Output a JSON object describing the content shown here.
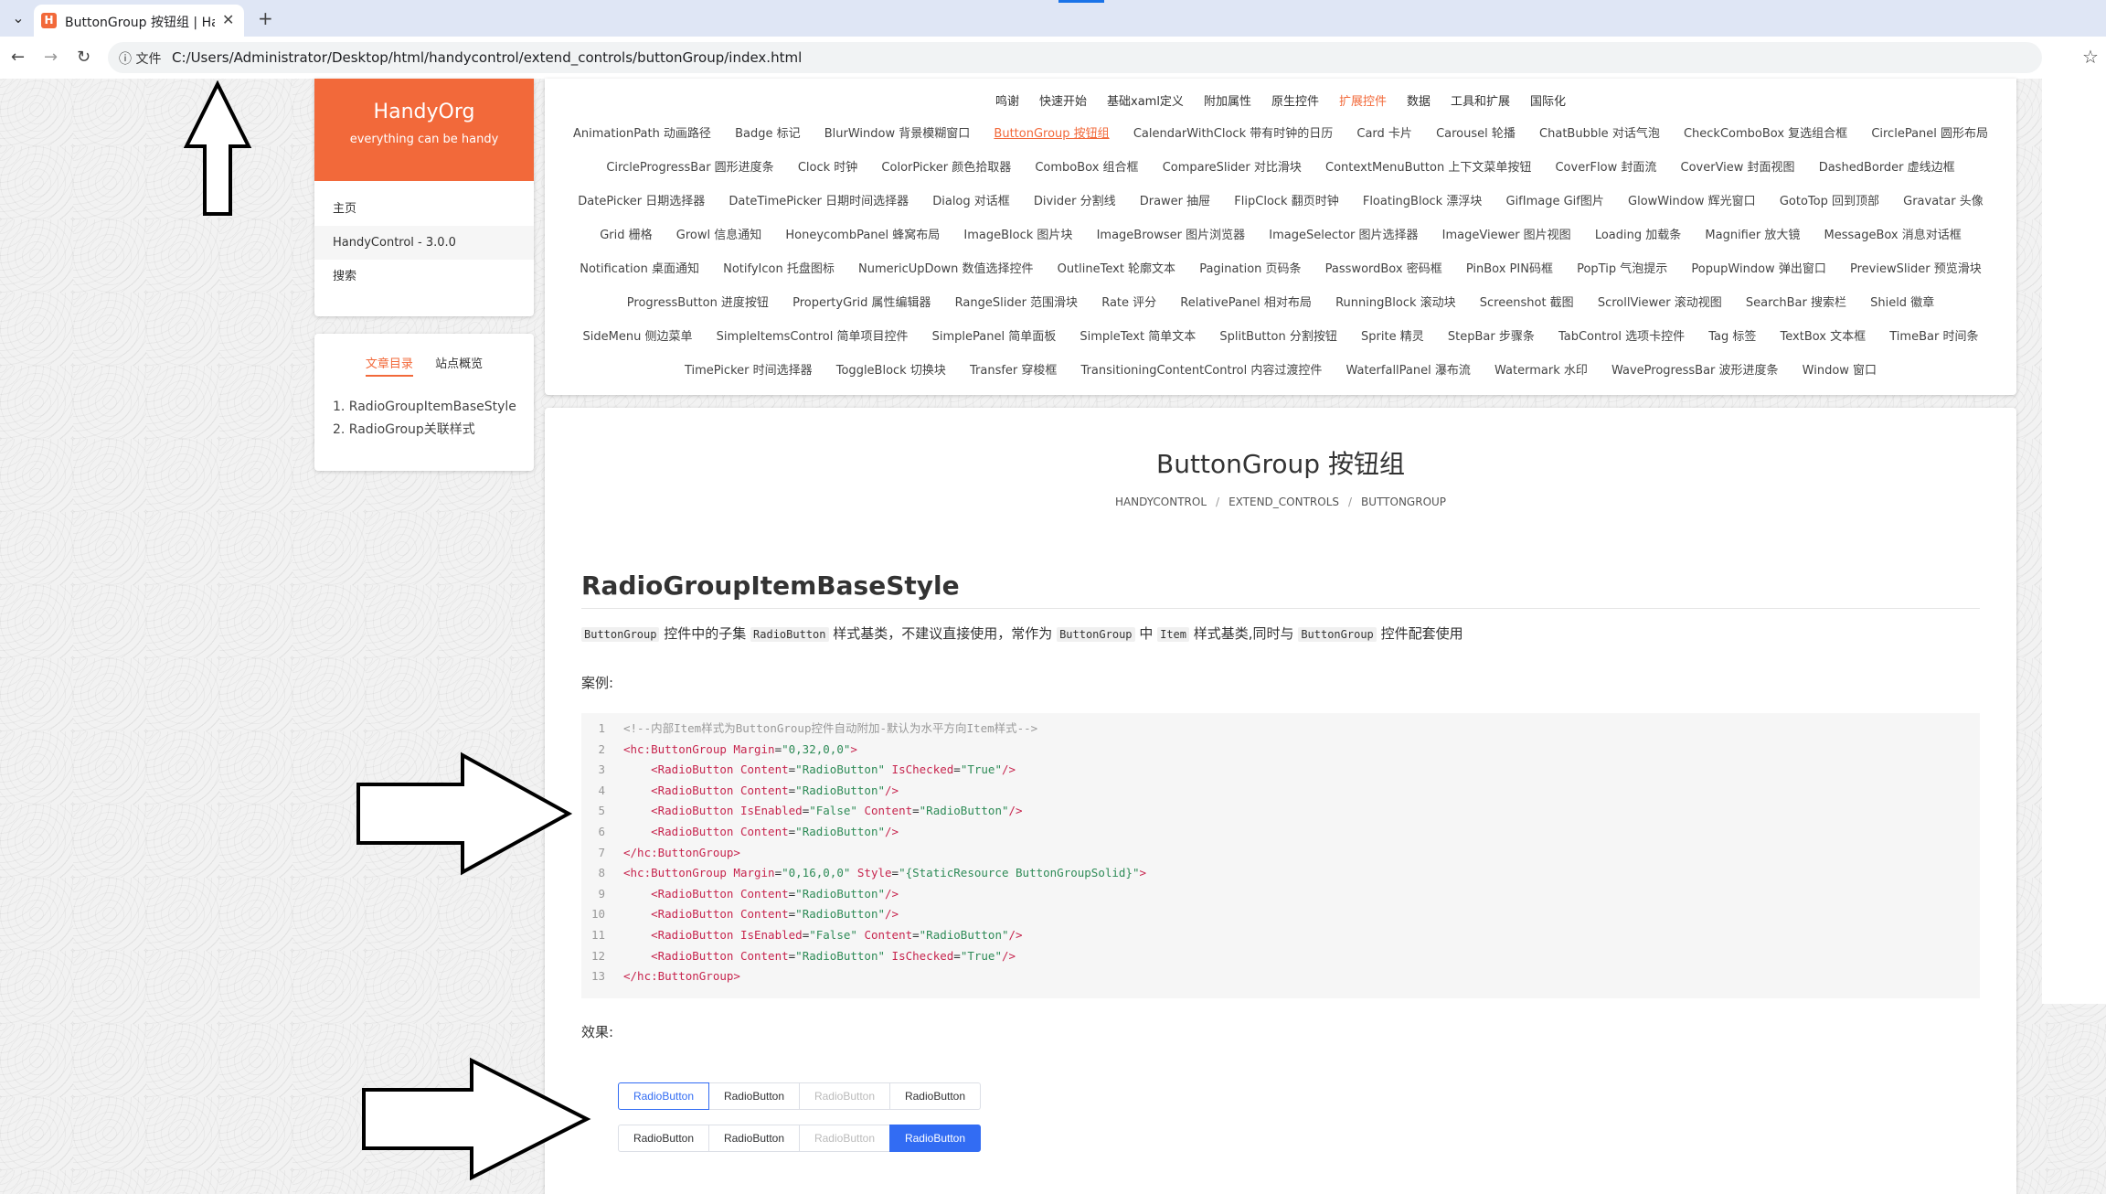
{
  "browser": {
    "tab_title": "ButtonGroup 按钮组 | HandyControl",
    "favicon_letter": "H",
    "site_info": "文件",
    "url": "C:/Users/Administrator/Desktop/html/handycontrol/extend_controls/buttonGroup/index.html"
  },
  "brand": {
    "title": "HandyOrg",
    "subtitle": "everything can be handy"
  },
  "nav": {
    "items": [
      "主页",
      "HandyControl - 3.0.0",
      "搜索"
    ]
  },
  "toc": {
    "tabs": [
      "文章目录",
      "站点概览"
    ],
    "items": [
      "1. RadioGroupItemBaseStyle",
      "2. RadioGroup关联样式"
    ]
  },
  "top_menu": [
    "鸣谢",
    "快速开始",
    "基础xaml定义",
    "附加属性",
    "原生控件",
    "扩展控件",
    "数据",
    "工具和扩展",
    "国际化"
  ],
  "controls": [
    "AnimationPath 动画路径",
    "Badge 标记",
    "BlurWindow 背景模糊窗口",
    "ButtonGroup 按钮组",
    "CalendarWithClock 带有时钟的日历",
    "Card 卡片",
    "Carousel 轮播",
    "ChatBubble 对话气泡",
    "CheckComboBox 复选组合框",
    "CirclePanel 圆形布局",
    "CircleProgressBar 圆形进度条",
    "Clock 时钟",
    "ColorPicker 颜色拾取器",
    "ComboBox 组合框",
    "CompareSlider 对比滑块",
    "ContextMenuButton 上下文菜单按钮",
    "CoverFlow 封面流",
    "CoverView 封面视图",
    "DashedBorder 虚线边框",
    "DatePicker 日期选择器",
    "DateTimePicker 日期时间选择器",
    "Dialog 对话框",
    "Divider 分割线",
    "Drawer 抽屉",
    "FlipClock 翻页时钟",
    "FloatingBlock 漂浮块",
    "GifImage Gif图片",
    "GlowWindow 辉光窗口",
    "GotoTop 回到顶部",
    "Gravatar 头像",
    "Grid 栅格",
    "Growl 信息通知",
    "HoneycombPanel 蜂窝布局",
    "ImageBlock 图片块",
    "ImageBrowser 图片浏览器",
    "ImageSelector 图片选择器",
    "ImageViewer 图片视图",
    "Loading 加载条",
    "Magnifier 放大镜",
    "MessageBox 消息对话框",
    "Notification 桌面通知",
    "NotifyIcon 托盘图标",
    "NumericUpDown 数值选择控件",
    "OutlineText 轮廓文本",
    "Pagination 页码条",
    "PasswordBox 密码框",
    "PinBox PIN码框",
    "PopTip 气泡提示",
    "PopupWindow 弹出窗口",
    "PreviewSlider 预览滑块",
    "ProgressButton 进度按钮",
    "PropertyGrid 属性编辑器",
    "RangeSlider 范围滑块",
    "Rate 评分",
    "RelativePanel 相对布局",
    "RunningBlock 滚动块",
    "Screenshot 截图",
    "ScrollViewer 滚动视图",
    "SearchBar 搜索栏",
    "Shield 徽章",
    "SideMenu 侧边菜单",
    "SimpleItemsControl 简单项目控件",
    "SimplePanel 简单面板",
    "SimpleText 简单文本",
    "SplitButton 分割按钮",
    "Sprite 精灵",
    "StepBar 步骤条",
    "TabControl 选项卡控件",
    "Tag 标签",
    "TextBox 文本框",
    "TimeBar 时间条",
    "TimePicker 时间选择器",
    "ToggleBlock 切换块",
    "Transfer 穿梭框",
    "TransitioningContentControl 内容过渡控件",
    "WaterfallPanel 瀑布流",
    "Watermark 水印",
    "WaveProgressBar 波形进度条",
    "Window 窗口"
  ],
  "content": {
    "title": "ButtonGroup 按钮组",
    "breadcrumb": [
      "HANDYCONTROL",
      "EXTEND_CONTROLS",
      "BUTTONGROUP"
    ],
    "section_title": "RadioGroupItemBaseStyle",
    "desc": {
      "code1": "ButtonGroup",
      "t1": " 控件中的子集 ",
      "code2": "RadioButton",
      "t2": " 样式基类，不建议直接使用，常作为 ",
      "code3": "ButtonGroup",
      "t3": " 中 ",
      "code4": "Item",
      "t4": " 样式基类,同时与 ",
      "code5": "ButtonGroup",
      "t5": " 控件配套使用"
    },
    "example_label": "案例:",
    "effect_label": "效果:",
    "code_lines": [
      "<!--内部Item样式为ButtonGroup控件自动附加-默认为水平方向Item样式-->",
      "<hc:ButtonGroup Margin=\"0,32,0,0\">",
      "    <RadioButton Content=\"RadioButton\" IsChecked=\"True\"/>",
      "    <RadioButton Content=\"RadioButton\"/>",
      "    <RadioButton IsEnabled=\"False\" Content=\"RadioButton\"/>",
      "    <RadioButton Content=\"RadioButton\"/>",
      "</hc:ButtonGroup>",
      "<hc:ButtonGroup Margin=\"0,16,0,0\" Style=\"{StaticResource ButtonGroupSolid}\">",
      "    <RadioButton Content=\"RadioButton\"/>",
      "    <RadioButton Content=\"RadioButton\"/>",
      "    <RadioButton IsEnabled=\"False\" Content=\"RadioButton\"/>",
      "    <RadioButton Content=\"RadioButton\" IsChecked=\"True\"/>",
      "</hc:ButtonGroup>"
    ],
    "groups": [
      {
        "buttons": [
          {
            "label": "RadioButton",
            "state": "checked"
          },
          {
            "label": "RadioButton",
            "state": "normal"
          },
          {
            "label": "RadioButton",
            "state": "disabled"
          },
          {
            "label": "RadioButton",
            "state": "normal"
          }
        ]
      },
      {
        "buttons": [
          {
            "label": "RadioButton",
            "state": "normal"
          },
          {
            "label": "RadioButton",
            "state": "normal"
          },
          {
            "label": "RadioButton",
            "state": "disabled"
          },
          {
            "label": "RadioButton",
            "state": "checked"
          }
        ]
      }
    ]
  },
  "colors": {
    "accent": "#f2693a",
    "primary": "#326cf3"
  }
}
